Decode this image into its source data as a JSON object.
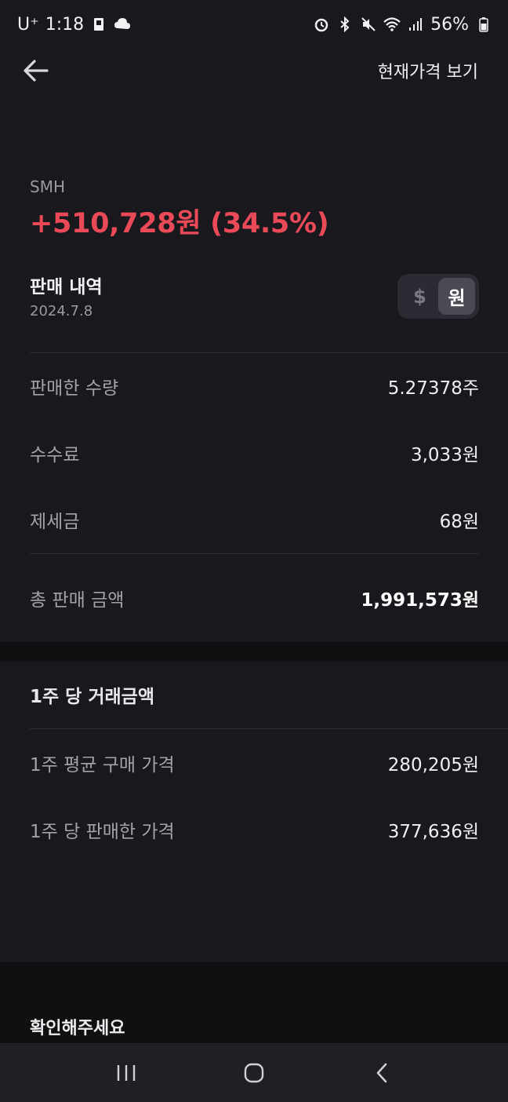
{
  "status_bar": {
    "carrier": "U⁺",
    "time": "1:18",
    "battery": "56%",
    "icons": [
      "notification-icon",
      "cloud-icon",
      "alarm-icon",
      "bluetooth-icon",
      "mute-icon",
      "wifi-icon",
      "signal-icon",
      "battery-icon"
    ]
  },
  "topbar": {
    "back_icon": "arrow-left-icon",
    "action_label": "현재가격 보기"
  },
  "summary": {
    "ticker": "SMH",
    "profit": "+510,728원 (34.5%)",
    "profit_color": "#ea4a58"
  },
  "sell": {
    "title": "판매 내역",
    "date": "2024.7.8",
    "currency_toggle": {
      "options": [
        "$",
        "원"
      ],
      "selected": "원"
    },
    "rows": [
      {
        "label": "판매한 수량",
        "value": "5.27378주"
      },
      {
        "label": "수수료",
        "value": "3,033원"
      },
      {
        "label": "제세금",
        "value": "68원"
      }
    ],
    "total": {
      "label": "총 판매 금액",
      "value": "1,991,573원"
    }
  },
  "per_share": {
    "title": "1주 당 거래금액",
    "rows": [
      {
        "label": "1주 평균 구매 가격",
        "value": "280,205원"
      },
      {
        "label": "1주 당 판매한 가격",
        "value": "377,636원"
      }
    ]
  },
  "notice": {
    "title": "확인해주세요"
  },
  "nav": {
    "icons": [
      "recent-apps-icon",
      "home-icon",
      "back-icon"
    ]
  }
}
